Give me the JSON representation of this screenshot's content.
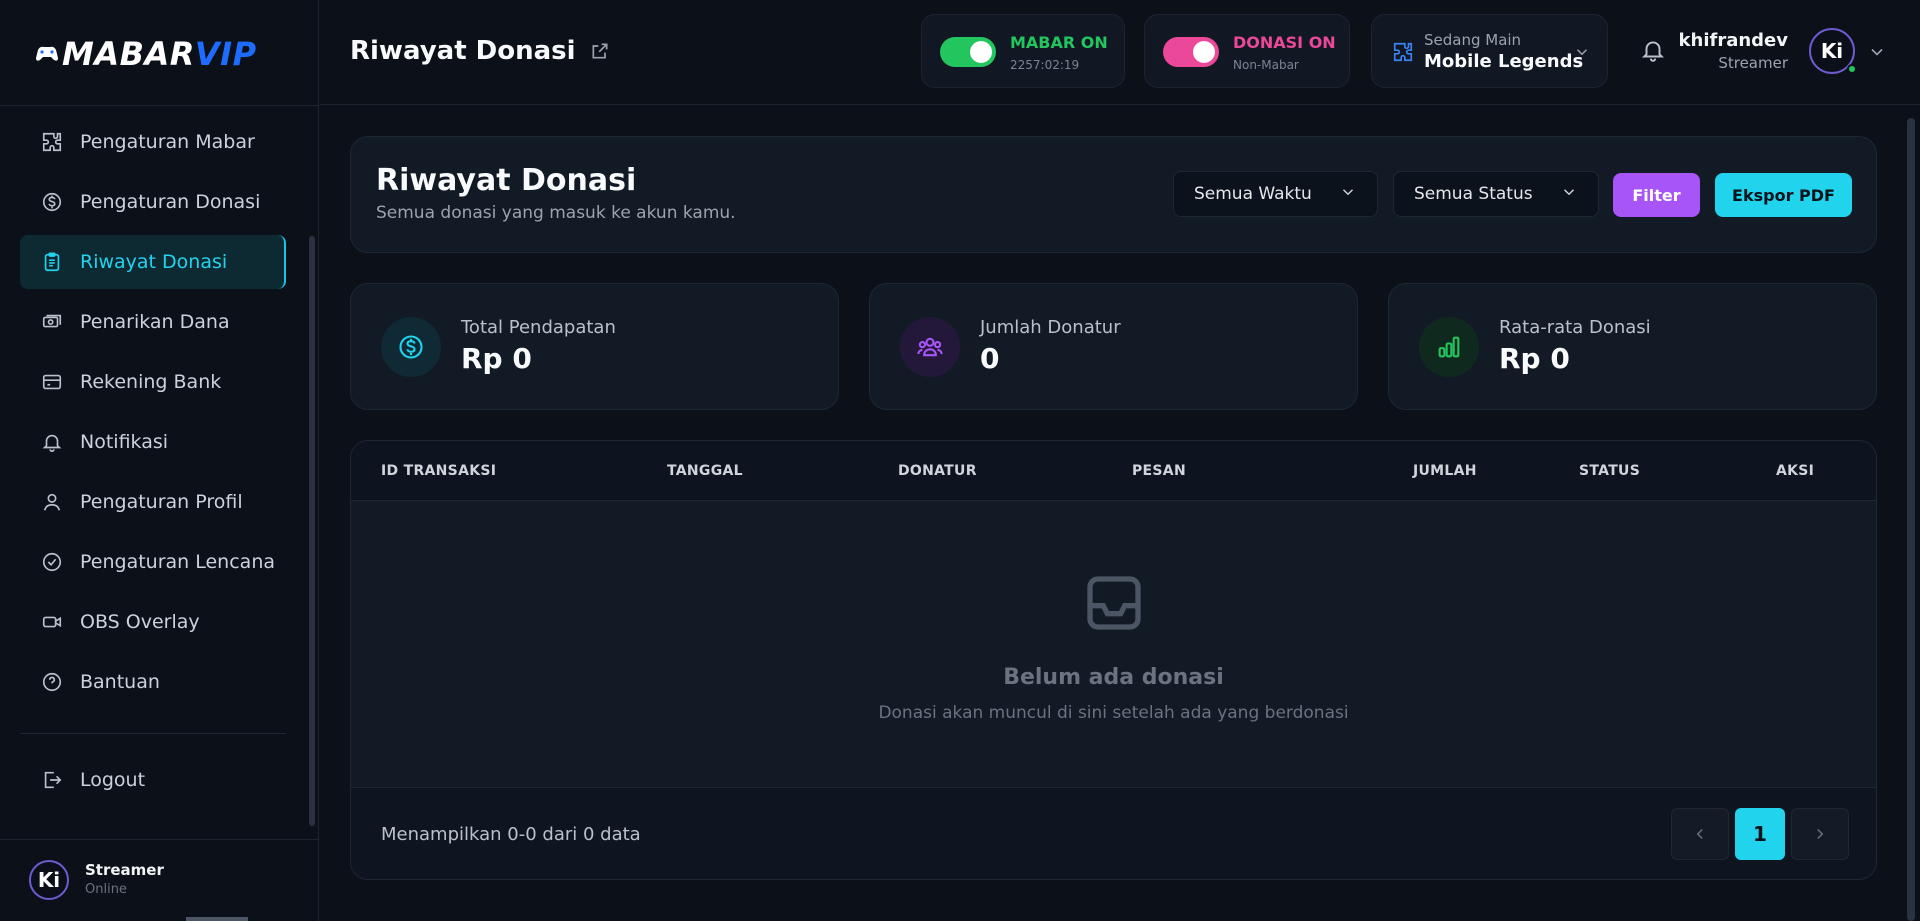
{
  "brand": {
    "logo_part1": "MABAR",
    "logo_part2": "VIP"
  },
  "sidebar": {
    "items": [
      {
        "label": "Pengaturan Mabar",
        "icon": "puzzle-icon"
      },
      {
        "label": "Pengaturan Donasi",
        "icon": "dollar-circle-icon"
      },
      {
        "label": "Riwayat Donasi",
        "icon": "clipboard-icon",
        "active": true
      },
      {
        "label": "Penarikan Dana",
        "icon": "cash-icon"
      },
      {
        "label": "Rekening Bank",
        "icon": "credit-card-icon"
      },
      {
        "label": "Notifikasi",
        "icon": "bell-icon"
      },
      {
        "label": "Pengaturan Profil",
        "icon": "user-icon"
      },
      {
        "label": "Pengaturan Lencana",
        "icon": "badge-check-icon"
      },
      {
        "label": "OBS Overlay",
        "icon": "video-icon"
      },
      {
        "label": "Bantuan",
        "icon": "help-circle-icon"
      }
    ],
    "logout": "Logout",
    "footer": {
      "name": "Streamer",
      "status": "Online",
      "avatar": "Ki"
    }
  },
  "header": {
    "title": "Riwayat Donasi",
    "mabar": {
      "label": "MABAR ON",
      "sub": "2257:02:19",
      "color": "#22c55e"
    },
    "donasi": {
      "label": "DONASI ON",
      "sub": "Non-Mabar",
      "color": "#ec4899"
    },
    "game": {
      "label": "Sedang Main",
      "value": "Mobile Legends"
    },
    "user": {
      "name": "khifrandev",
      "role": "Streamer",
      "avatar": "Ki"
    }
  },
  "main": {
    "heading": "Riwayat Donasi",
    "subheading": "Semua donasi yang masuk ke akun kamu.",
    "filters": {
      "time": "Semua Waktu",
      "status": "Semua Status"
    },
    "buttons": {
      "filter": "Filter",
      "export": "Ekspor PDF"
    },
    "stats": [
      {
        "label": "Total Pendapatan",
        "value": "Rp 0"
      },
      {
        "label": "Jumlah Donatur",
        "value": "0"
      },
      {
        "label": "Rata-rata Donasi",
        "value": "Rp 0"
      }
    ],
    "table": {
      "columns": [
        "ID TRANSAKSI",
        "TANGGAL",
        "DONATUR",
        "PESAN",
        "JUMLAH",
        "STATUS",
        "AKSI"
      ],
      "empty_title": "Belum ada donasi",
      "empty_sub": "Donasi akan muncul di sini setelah ada yang berdonasi",
      "footer_info": "Menampilkan 0-0 dari 0 data",
      "current_page": "1"
    }
  },
  "colors": {
    "accent": "#22d3ee",
    "purple": "#a855f7",
    "green": "#22c55e",
    "pink": "#ec4899"
  }
}
